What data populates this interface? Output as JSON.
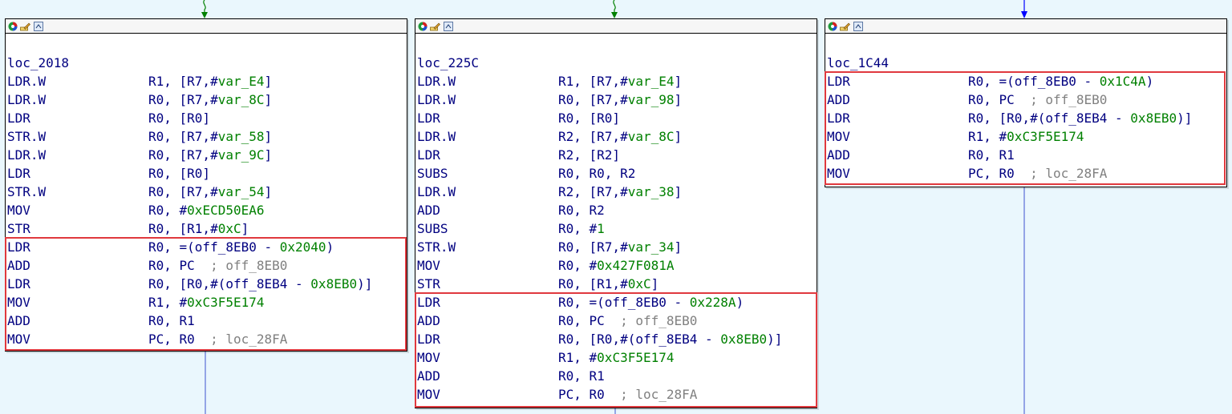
{
  "blocks": [
    {
      "label": "loc_2018",
      "lines": [
        {
          "m": "LDR.W",
          "ops": [
            {
              "t": "R1, [R7,#"
            },
            {
              "t": "var_E4",
              "c": "g"
            },
            {
              "t": "]"
            }
          ]
        },
        {
          "m": "LDR.W",
          "ops": [
            {
              "t": "R0, [R7,#"
            },
            {
              "t": "var_8C",
              "c": "g"
            },
            {
              "t": "]"
            }
          ]
        },
        {
          "m": "LDR",
          "ops": [
            {
              "t": "R0, [R0]"
            }
          ]
        },
        {
          "m": "STR.W",
          "ops": [
            {
              "t": "R0, [R7,#"
            },
            {
              "t": "var_58",
              "c": "g"
            },
            {
              "t": "]"
            }
          ]
        },
        {
          "m": "LDR.W",
          "ops": [
            {
              "t": "R0, [R7,#"
            },
            {
              "t": "var_9C",
              "c": "g"
            },
            {
              "t": "]"
            }
          ]
        },
        {
          "m": "LDR",
          "ops": [
            {
              "t": "R0, [R0]"
            }
          ]
        },
        {
          "m": "STR.W",
          "ops": [
            {
              "t": "R0, [R7,#"
            },
            {
              "t": "var_54",
              "c": "g"
            },
            {
              "t": "]"
            }
          ]
        },
        {
          "m": "MOV",
          "ops": [
            {
              "t": "R0, #"
            },
            {
              "t": "0xECD50EA6",
              "c": "g"
            }
          ]
        },
        {
          "m": "STR",
          "ops": [
            {
              "t": "R0, [R1,#"
            },
            {
              "t": "0xC",
              "c": "g"
            },
            {
              "t": "]"
            }
          ]
        },
        {
          "m": "LDR",
          "ops": [
            {
              "t": "R0, =(off_8EB0 - "
            },
            {
              "t": "0x2040",
              "c": "g"
            },
            {
              "t": ")"
            }
          ]
        },
        {
          "m": "ADD",
          "ops": [
            {
              "t": "R0, PC  "
            },
            {
              "t": "; off_8EB0",
              "c": "c"
            }
          ]
        },
        {
          "m": "LDR",
          "ops": [
            {
              "t": "R0, [R0,#(off_8EB4 - "
            },
            {
              "t": "0x8EB0",
              "c": "g"
            },
            {
              "t": ")]"
            }
          ]
        },
        {
          "m": "MOV",
          "ops": [
            {
              "t": "R1, #"
            },
            {
              "t": "0xC3F5E174",
              "c": "g"
            }
          ]
        },
        {
          "m": "ADD",
          "ops": [
            {
              "t": "R0, R1"
            }
          ]
        },
        {
          "m": "MOV",
          "ops": [
            {
              "t": "PC, R0  "
            },
            {
              "t": "; loc_28FA",
              "c": "c"
            }
          ]
        }
      ]
    },
    {
      "label": "loc_225C",
      "lines": [
        {
          "m": "LDR.W",
          "ops": [
            {
              "t": "R1, [R7,#"
            },
            {
              "t": "var_E4",
              "c": "g"
            },
            {
              "t": "]"
            }
          ]
        },
        {
          "m": "LDR.W",
          "ops": [
            {
              "t": "R0, [R7,#"
            },
            {
              "t": "var_98",
              "c": "g"
            },
            {
              "t": "]"
            }
          ]
        },
        {
          "m": "LDR",
          "ops": [
            {
              "t": "R0, [R0]"
            }
          ]
        },
        {
          "m": "LDR.W",
          "ops": [
            {
              "t": "R2, [R7,#"
            },
            {
              "t": "var_8C",
              "c": "g"
            },
            {
              "t": "]"
            }
          ]
        },
        {
          "m": "LDR",
          "ops": [
            {
              "t": "R2, [R2]"
            }
          ]
        },
        {
          "m": "SUBS",
          "ops": [
            {
              "t": "R0, R0, R2"
            }
          ]
        },
        {
          "m": "LDR.W",
          "ops": [
            {
              "t": "R2, [R7,#"
            },
            {
              "t": "var_38",
              "c": "g"
            },
            {
              "t": "]"
            }
          ]
        },
        {
          "m": "ADD",
          "ops": [
            {
              "t": "R0, R2"
            }
          ]
        },
        {
          "m": "SUBS",
          "ops": [
            {
              "t": "R0, #"
            },
            {
              "t": "1",
              "c": "g"
            }
          ]
        },
        {
          "m": "STR.W",
          "ops": [
            {
              "t": "R0, [R7,#"
            },
            {
              "t": "var_34",
              "c": "g"
            },
            {
              "t": "]"
            }
          ]
        },
        {
          "m": "MOV",
          "ops": [
            {
              "t": "R0, #"
            },
            {
              "t": "0x427F081A",
              "c": "g"
            }
          ]
        },
        {
          "m": "STR",
          "ops": [
            {
              "t": "R0, [R1,#"
            },
            {
              "t": "0xC",
              "c": "g"
            },
            {
              "t": "]"
            }
          ]
        },
        {
          "m": "LDR",
          "ops": [
            {
              "t": "R0, =(off_8EB0 - "
            },
            {
              "t": "0x228A",
              "c": "g"
            },
            {
              "t": ")"
            }
          ]
        },
        {
          "m": "ADD",
          "ops": [
            {
              "t": "R0, PC  "
            },
            {
              "t": "; off_8EB0",
              "c": "c"
            }
          ]
        },
        {
          "m": "LDR",
          "ops": [
            {
              "t": "R0, [R0,#(off_8EB4 - "
            },
            {
              "t": "0x8EB0",
              "c": "g"
            },
            {
              "t": ")]"
            }
          ]
        },
        {
          "m": "MOV",
          "ops": [
            {
              "t": "R1, #"
            },
            {
              "t": "0xC3F5E174",
              "c": "g"
            }
          ]
        },
        {
          "m": "ADD",
          "ops": [
            {
              "t": "R0, R1"
            }
          ]
        },
        {
          "m": "MOV",
          "ops": [
            {
              "t": "PC, R0  "
            },
            {
              "t": "; loc_28FA",
              "c": "c"
            }
          ]
        }
      ]
    },
    {
      "label": "loc_1C44",
      "lines": [
        {
          "m": "LDR",
          "ops": [
            {
              "t": "R0, =(off_8EB0 - "
            },
            {
              "t": "0x1C4A",
              "c": "g"
            },
            {
              "t": ")"
            }
          ]
        },
        {
          "m": "ADD",
          "ops": [
            {
              "t": "R0, PC  "
            },
            {
              "t": "; off_8EB0",
              "c": "c"
            }
          ]
        },
        {
          "m": "LDR",
          "ops": [
            {
              "t": "R0, [R0,#(off_8EB4 - "
            },
            {
              "t": "0x8EB0",
              "c": "g"
            },
            {
              "t": ")]"
            }
          ]
        },
        {
          "m": "MOV",
          "ops": [
            {
              "t": "R1, #"
            },
            {
              "t": "0xC3F5E174",
              "c": "g"
            }
          ]
        },
        {
          "m": "ADD",
          "ops": [
            {
              "t": "R0, R1"
            }
          ]
        },
        {
          "m": "MOV",
          "ops": [
            {
              "t": "PC, R0  "
            },
            {
              "t": "; loc_28FA",
              "c": "c"
            }
          ]
        }
      ]
    }
  ],
  "colors": {
    "background": "#eaf7fd",
    "instruction": "#000080",
    "constant": "#008000",
    "comment": "#808080",
    "highlight_box": "#e0393e",
    "edge_green": "#008000",
    "edge_blue": "#0000ff",
    "edge_line": "#5b6fd6"
  },
  "toolbar_icons": [
    "color-palette-icon",
    "rename-icon",
    "graph-overview-icon"
  ]
}
